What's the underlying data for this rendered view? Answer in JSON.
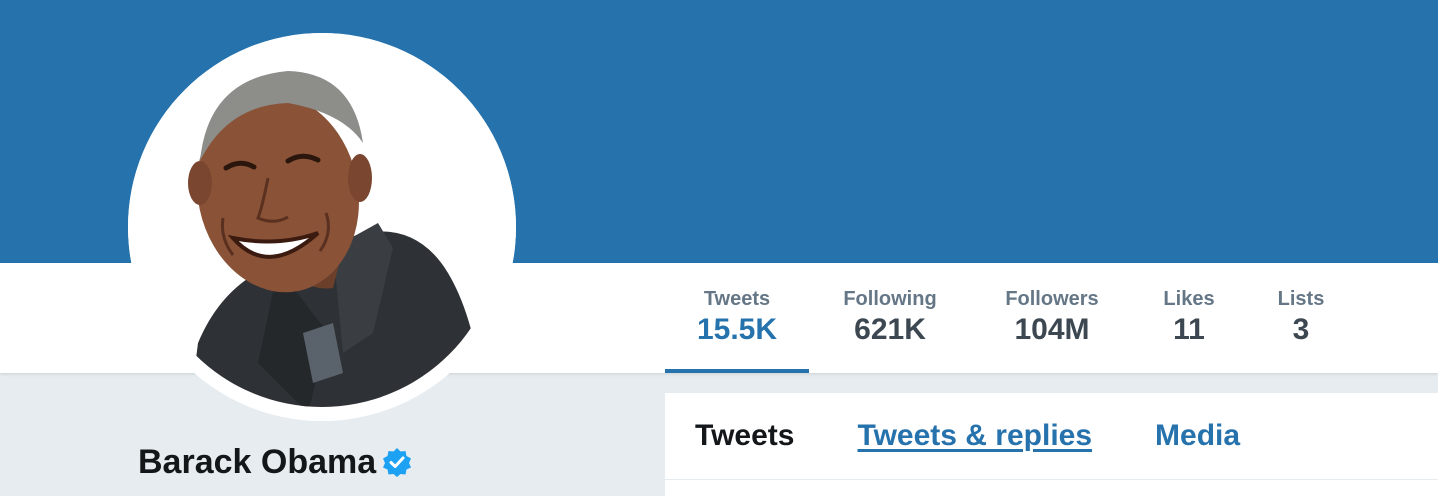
{
  "profile": {
    "name": "Barack Obama",
    "verified": true,
    "accent_color": "#2572ad",
    "avatar_icon": "profile-photo"
  },
  "stats": [
    {
      "label": "Tweets",
      "value": "15.5K",
      "active": true
    },
    {
      "label": "Following",
      "value": "621K",
      "active": false
    },
    {
      "label": "Followers",
      "value": "104M",
      "active": false
    },
    {
      "label": "Likes",
      "value": "11",
      "active": false
    },
    {
      "label": "Lists",
      "value": "3",
      "active": false
    }
  ],
  "tabs": [
    {
      "label": "Tweets",
      "active": true
    },
    {
      "label": "Tweets & replies",
      "active": false
    },
    {
      "label": "Media",
      "active": false
    }
  ]
}
